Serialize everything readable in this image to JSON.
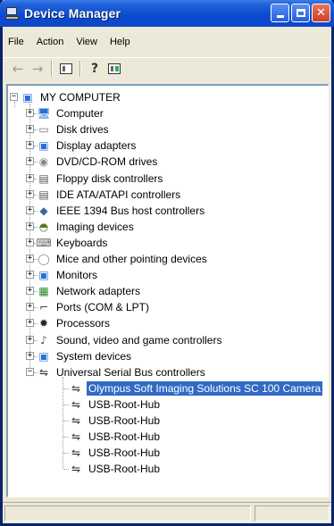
{
  "window": {
    "title": "Device Manager"
  },
  "menu": [
    "File",
    "Action",
    "View",
    "Help"
  ],
  "toolbar": {
    "back": "←",
    "forward": "→",
    "help": "?"
  },
  "tree": {
    "root": "MY COMPUTER",
    "categories": [
      {
        "label": "Computer",
        "icon": "computer-icon",
        "glyph": "🖥",
        "color": "#2a6fd6"
      },
      {
        "label": "Disk drives",
        "icon": "disk-drive-icon",
        "glyph": "▭",
        "color": "#777777"
      },
      {
        "label": "Display adapters",
        "icon": "display-adapter-icon",
        "glyph": "▣",
        "color": "#2a6fd6"
      },
      {
        "label": "DVD/CD-ROM drives",
        "icon": "cd-drive-icon",
        "glyph": "◉",
        "color": "#888888"
      },
      {
        "label": "Floppy disk controllers",
        "icon": "floppy-controller-icon",
        "glyph": "▤",
        "color": "#555555"
      },
      {
        "label": "IDE ATA/ATAPI controllers",
        "icon": "ide-controller-icon",
        "glyph": "▤",
        "color": "#555555"
      },
      {
        "label": "IEEE 1394 Bus host controllers",
        "icon": "ieee1394-icon",
        "glyph": "◆",
        "color": "#3a6a9a"
      },
      {
        "label": "Imaging devices",
        "icon": "imaging-device-icon",
        "glyph": "◓",
        "color": "#5a7a2a"
      },
      {
        "label": "Keyboards",
        "icon": "keyboard-icon",
        "glyph": "⌨",
        "color": "#666666"
      },
      {
        "label": "Mice and other pointing devices",
        "icon": "mouse-icon",
        "glyph": "◯",
        "color": "#888888"
      },
      {
        "label": "Monitors",
        "icon": "monitor-icon",
        "glyph": "▣",
        "color": "#2a6fd6"
      },
      {
        "label": "Network adapters",
        "icon": "network-adapter-icon",
        "glyph": "▦",
        "color": "#2a8a2a"
      },
      {
        "label": "Ports (COM & LPT)",
        "icon": "port-icon",
        "glyph": "⌐",
        "color": "#444444"
      },
      {
        "label": "Processors",
        "icon": "processor-icon",
        "glyph": "✹",
        "color": "#222222"
      },
      {
        "label": "Sound, video and game controllers",
        "icon": "sound-icon",
        "glyph": "♪",
        "color": "#555555"
      },
      {
        "label": "System devices",
        "icon": "system-device-icon",
        "glyph": "▣",
        "color": "#2a6fd6"
      },
      {
        "label": "Universal Serial Bus controllers",
        "icon": "usb-icon",
        "glyph": "⇋",
        "color": "#222222"
      }
    ],
    "usb_children": [
      {
        "label": "Olympus Soft Imaging Solutions SC 100 Camera",
        "selected": true
      },
      {
        "label": "USB-Root-Hub",
        "selected": false
      },
      {
        "label": "USB-Root-Hub",
        "selected": false
      },
      {
        "label": "USB-Root-Hub",
        "selected": false
      },
      {
        "label": "USB-Root-Hub",
        "selected": false
      },
      {
        "label": "USB-Root-Hub",
        "selected": false
      }
    ]
  },
  "colors": {
    "title_bar": "#0b4ad0",
    "selection": "#316ac5",
    "chrome": "#ece9d8"
  }
}
